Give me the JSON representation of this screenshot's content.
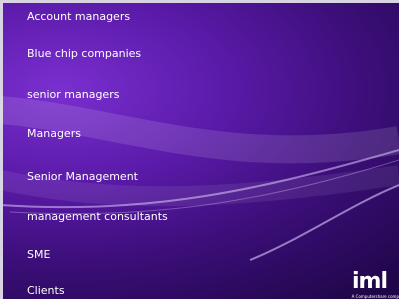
{
  "slide": {
    "items": [
      {
        "label": "Account managers"
      },
      {
        "label": "Blue chip companies"
      },
      {
        "label": "senior managers"
      },
      {
        "label": "Managers"
      },
      {
        "label": "Senior Management"
      },
      {
        "label": "management consultants"
      },
      {
        "label": "SME"
      },
      {
        "label": "Clients"
      }
    ],
    "logo": "iml",
    "tagline": "A Computershare comp"
  },
  "colors": {
    "background_light": "#7a2fd0",
    "background_dark": "#1f0648",
    "text": "#ffffff",
    "border": "#d8d4e4"
  }
}
